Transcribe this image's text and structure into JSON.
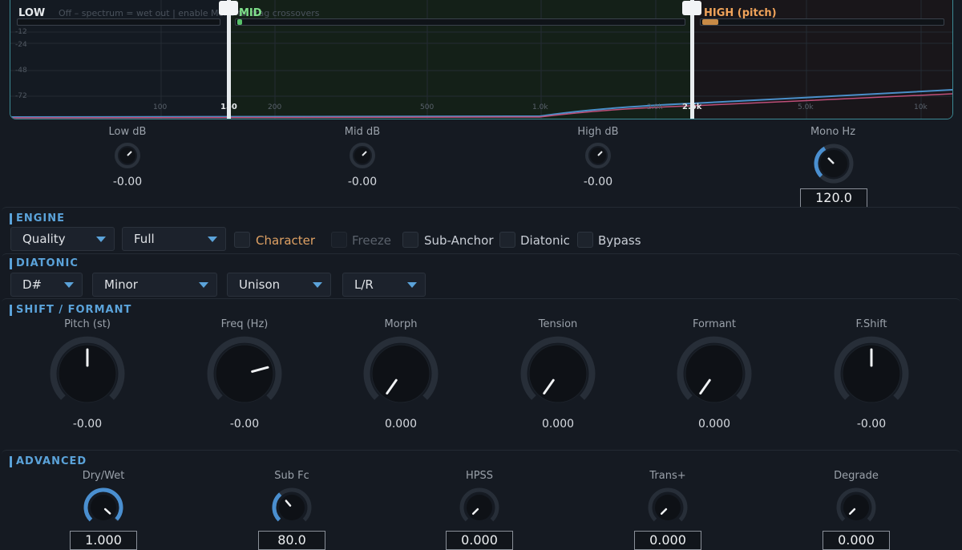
{
  "spectrum": {
    "hint": "Off – spectrum = wet out  |  enable Mono to drag crossovers",
    "bands": [
      {
        "label": "LOW",
        "color": "#e6e9ec"
      },
      {
        "label": "MID",
        "color": "#7fe08a"
      },
      {
        "label": "HIGH (pitch)",
        "color": "#f0a35a"
      }
    ],
    "db_ticks": [
      "-12",
      "-24",
      "-48",
      "-72"
    ],
    "freq_ticks": [
      "100",
      "200",
      "500",
      "1.0k",
      "2.0k",
      "5.0k",
      "10k"
    ],
    "crossovers": [
      "150",
      "2.5k"
    ],
    "colors": {
      "border": "#3c8a95",
      "curve_blue": "#4a8fc9",
      "curve_pink": "#c0507a"
    }
  },
  "band_knobs": [
    {
      "label": "Low dB",
      "value": "-0.00"
    },
    {
      "label": "Mid dB",
      "value": "-0.00"
    },
    {
      "label": "High dB",
      "value": "-0.00"
    },
    {
      "label": "Mono Hz",
      "value": "120.0"
    }
  ],
  "engine": {
    "title": "ENGINE",
    "quality": "Quality",
    "mode": "Full",
    "toggles": [
      {
        "label": "Character",
        "enabled": true,
        "highlight": true
      },
      {
        "label": "Freeze",
        "enabled": false
      },
      {
        "label": "Sub-Anchor",
        "enabled": true
      },
      {
        "label": "Diatonic",
        "enabled": true
      },
      {
        "label": "Bypass",
        "enabled": true
      }
    ]
  },
  "diatonic": {
    "title": "DIATONIC",
    "key": "D#",
    "scale": "Minor",
    "voicing": "Unison",
    "stereo": "L/R"
  },
  "shift": {
    "title": "SHIFT / FORMANT",
    "knobs": [
      {
        "label": "Pitch (st)",
        "value": "-0.00"
      },
      {
        "label": "Freq (Hz)",
        "value": "-0.00"
      },
      {
        "label": "Morph",
        "value": "0.000"
      },
      {
        "label": "Tension",
        "value": "0.000"
      },
      {
        "label": "Formant",
        "value": "0.000"
      },
      {
        "label": "F.Shift",
        "value": "-0.00"
      }
    ]
  },
  "advanced": {
    "title": "ADVANCED",
    "knobs": [
      {
        "label": "Dry/Wet",
        "value": "1.000"
      },
      {
        "label": "Sub Fc",
        "value": "80.0"
      },
      {
        "label": "HPSS",
        "value": "0.000"
      },
      {
        "label": "Trans+",
        "value": "0.000"
      },
      {
        "label": "Degrade",
        "value": "0.000"
      }
    ]
  },
  "accent": "#5ba3da"
}
